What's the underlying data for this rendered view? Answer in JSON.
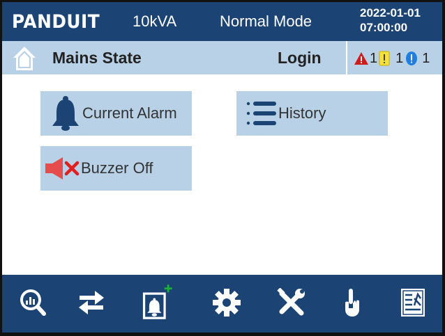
{
  "header": {
    "brand": "PANDUIT",
    "rating": "10kVA",
    "mode": "Normal Mode",
    "date": "2022-01-01",
    "time": "07:00:00"
  },
  "statebar": {
    "state": "Mains State",
    "login": "Login",
    "alarm_counts": {
      "critical": "1",
      "warning": "1",
      "info": "1"
    }
  },
  "main": {
    "buttons": {
      "current_alarm": "Current Alarm",
      "history": "History",
      "buzzer_off": "Buzzer Off"
    }
  },
  "bottom_nav": {
    "icons": [
      "monitor-icon",
      "transfer-icon",
      "alarm-setting-icon",
      "settings-gear-icon",
      "maintenance-tools-icon",
      "touch-icon",
      "log-document-icon"
    ]
  },
  "colors": {
    "header_blue": "#1b4475",
    "light_blue": "#b8d1e6",
    "alarm_red": "#d11a1a",
    "warning_yellow": "#f4e041",
    "info_blue": "#1e7fe0"
  }
}
